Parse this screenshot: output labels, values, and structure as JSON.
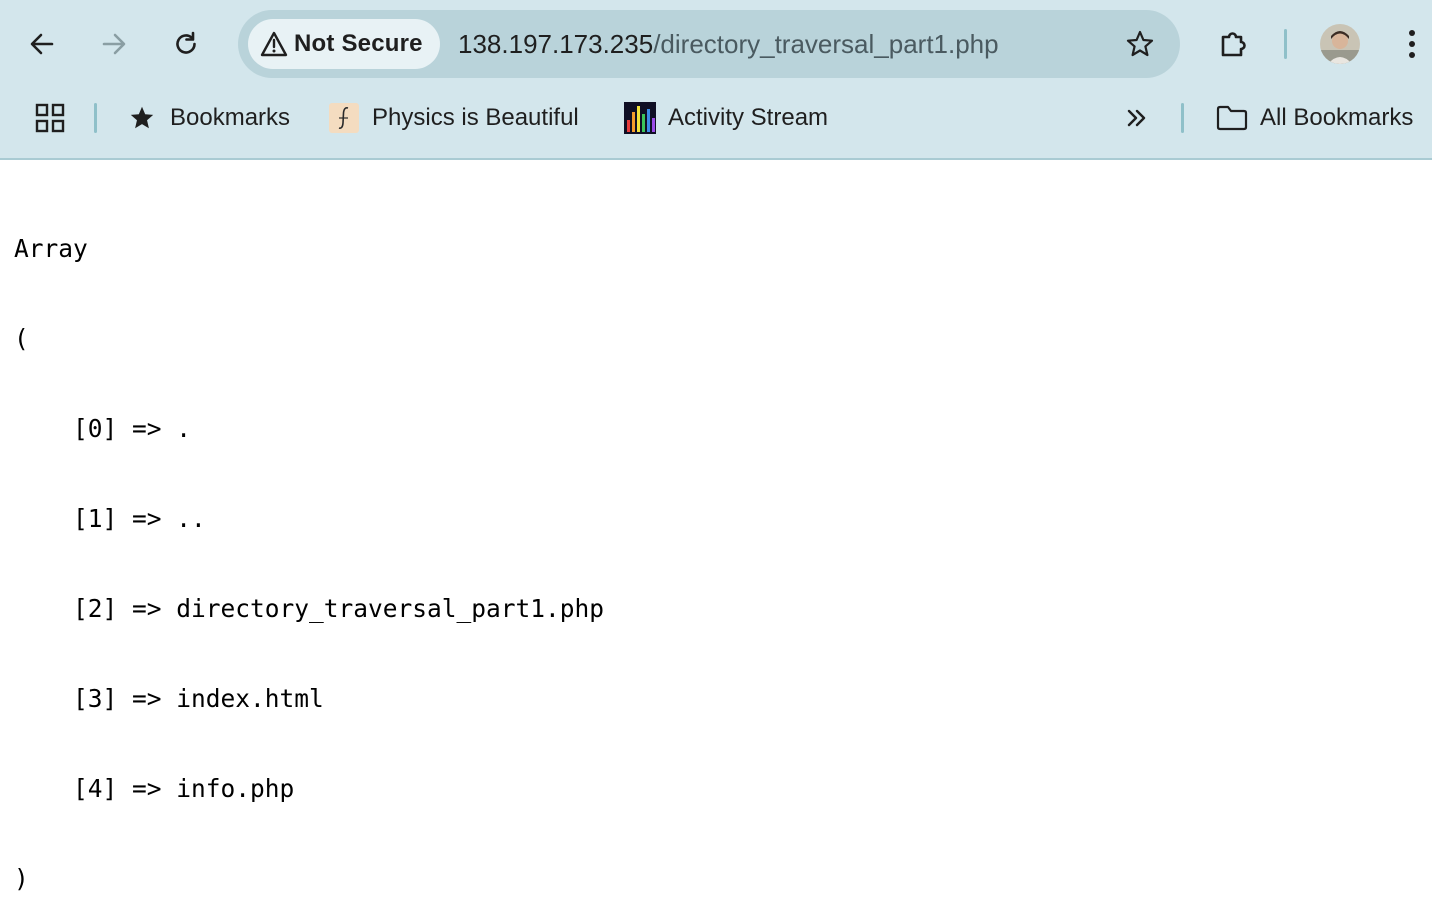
{
  "browser": {
    "security_label": "Not Secure",
    "url_host": "138.197.173.235",
    "url_path": "/directory_traversal_part1.php",
    "nav_icons": [
      "back-arrow-icon",
      "forward-arrow-icon",
      "reload-icon"
    ],
    "toolbar_icons": [
      "star-icon",
      "extensions-puzzle-icon",
      "kebab-menu-icon"
    ]
  },
  "bookmarks_bar": {
    "items": [
      {
        "label": "Bookmarks",
        "icon": "star-filled-icon"
      },
      {
        "label": "Physics is Beautiful",
        "icon": "physics-favicon"
      },
      {
        "label": "Activity Stream",
        "icon": "activity-stream-favicon"
      }
    ],
    "all_bookmarks_label": "All Bookmarks"
  },
  "page": {
    "lines": [
      "Array",
      "(",
      "    [0] => .",
      "    [1] => ..",
      "    [2] => directory_traversal_part1.php",
      "    [3] => index.html",
      "    [4] => info.php",
      ")"
    ]
  },
  "colors": {
    "chrome_bg": "#d3e6ec",
    "omnibox_bg": "#b9d3da",
    "chip_bg": "#e8f2f5",
    "separator": "#8fc0c9"
  }
}
